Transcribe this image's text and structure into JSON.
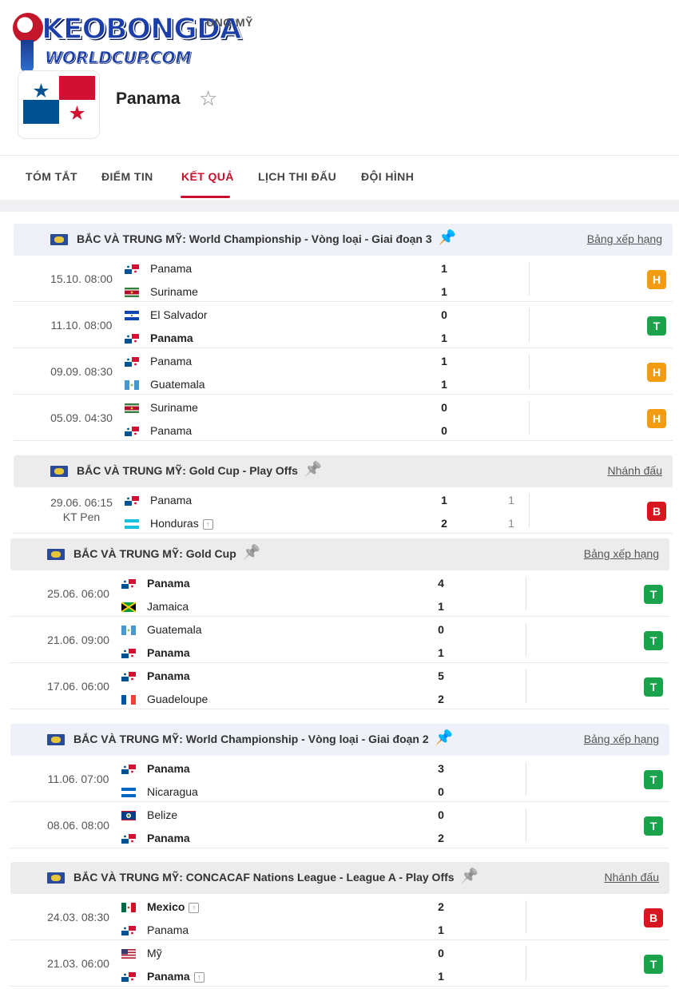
{
  "logo": {
    "line1": "KEOBONGDA",
    "line2": "WORLDCUP.COM"
  },
  "breadcrumb": "UNG MỸ",
  "team": {
    "name": "Panama"
  },
  "tabs": [
    {
      "label": "TÓM TẮT"
    },
    {
      "label": "ĐIỂM TIN"
    },
    {
      "label": "KẾT QUẢ"
    },
    {
      "label": "LỊCH THI ĐẤU"
    },
    {
      "label": "ĐỘI HÌNH"
    }
  ],
  "colors": {
    "accent": "#c8102e",
    "draw": "#f39c12",
    "win": "#1aa34a",
    "loss": "#d8161f",
    "pin": "#1e63d6"
  },
  "sections": [
    {
      "title": "BẮC VÀ TRUNG MỸ: World Championship - Vòng loại - Giai đoạn 3",
      "pinned": true,
      "link": "Bảng xếp hạng",
      "matches": [
        {
          "time": "15.10. 08:00",
          "home": {
            "name": "Panama",
            "flag": "PAN",
            "score": "1",
            "bold": false
          },
          "away": {
            "name": "Suriname",
            "flag": "SUR",
            "score": "1",
            "bold": false
          },
          "result": "H"
        },
        {
          "time": "11.10. 08:00",
          "home": {
            "name": "El Salvador",
            "flag": "SLV",
            "score": "0",
            "bold": false
          },
          "away": {
            "name": "Panama",
            "flag": "PAN",
            "score": "1",
            "bold": true
          },
          "result": "T"
        },
        {
          "time": "09.09. 08:30",
          "home": {
            "name": "Panama",
            "flag": "PAN",
            "score": "1",
            "bold": false
          },
          "away": {
            "name": "Guatemala",
            "flag": "GUA",
            "score": "1",
            "bold": false
          },
          "result": "H"
        },
        {
          "time": "05.09. 04:30",
          "home": {
            "name": "Suriname",
            "flag": "SUR",
            "score": "0",
            "bold": false
          },
          "away": {
            "name": "Panama",
            "flag": "PAN",
            "score": "0",
            "bold": false
          },
          "result": "H"
        }
      ]
    },
    {
      "title": "BẮC VÀ TRUNG MỸ: Gold Cup - Play Offs",
      "pinned": false,
      "link": "Nhánh đấu",
      "matches": [
        {
          "time": "29.06. 06:15",
          "status": "KT Pen",
          "home": {
            "name": "Panama",
            "flag": "PAN",
            "score": "1",
            "pen": "1",
            "bold": false
          },
          "away": {
            "name": "Honduras",
            "flag": "HON",
            "score": "2",
            "pen": "1",
            "bold": false,
            "up": "↑"
          },
          "result": "B"
        }
      ]
    },
    {
      "title": "BẮC VÀ TRUNG MỸ: Gold Cup",
      "pinned": false,
      "link": "Bảng xếp hạng",
      "matches": [
        {
          "time": "25.06. 06:00",
          "home": {
            "name": "Panama",
            "flag": "PAN",
            "score": "4",
            "bold": true
          },
          "away": {
            "name": "Jamaica",
            "flag": "JAM",
            "score": "1",
            "bold": false
          },
          "result": "T"
        },
        {
          "time": "21.06. 09:00",
          "home": {
            "name": "Guatemala",
            "flag": "GUA",
            "score": "0",
            "bold": false
          },
          "away": {
            "name": "Panama",
            "flag": "PAN",
            "score": "1",
            "bold": true
          },
          "result": "T"
        },
        {
          "time": "17.06. 06:00",
          "home": {
            "name": "Panama",
            "flag": "PAN",
            "score": "5",
            "bold": true
          },
          "away": {
            "name": "Guadeloupe",
            "flag": "GLP",
            "score": "2",
            "bold": false
          },
          "result": "T"
        }
      ]
    },
    {
      "title": "BẮC VÀ TRUNG MỸ: World Championship - Vòng loại - Giai đoạn 2",
      "pinned": true,
      "link": "Bảng xếp hạng",
      "matches": [
        {
          "time": "11.06. 07:00",
          "home": {
            "name": "Panama",
            "flag": "PAN",
            "score": "3",
            "bold": true
          },
          "away": {
            "name": "Nicaragua",
            "flag": "NCA",
            "score": "0",
            "bold": false
          },
          "result": "T"
        },
        {
          "time": "08.06. 08:00",
          "home": {
            "name": "Belize",
            "flag": "BLZ",
            "score": "0",
            "bold": false
          },
          "away": {
            "name": "Panama",
            "flag": "PAN",
            "score": "2",
            "bold": true
          },
          "result": "T"
        }
      ]
    },
    {
      "title": "BẮC VÀ TRUNG MỸ: CONCACAF Nations League - League A - Play Offs",
      "pinned": false,
      "link": "Nhánh đấu",
      "matches": [
        {
          "time": "24.03. 08:30",
          "home": {
            "name": "Mexico",
            "flag": "MEX",
            "score": "2",
            "bold": true,
            "up": "↑"
          },
          "away": {
            "name": "Panama",
            "flag": "PAN",
            "score": "1",
            "bold": false
          },
          "result": "B"
        },
        {
          "time": "21.03. 06:00",
          "home": {
            "name": "Mỹ",
            "flag": "USA",
            "score": "0",
            "bold": false
          },
          "away": {
            "name": "Panama",
            "flag": "PAN",
            "score": "1",
            "bold": true,
            "up": "↑"
          },
          "result": "T"
        }
      ]
    }
  ]
}
